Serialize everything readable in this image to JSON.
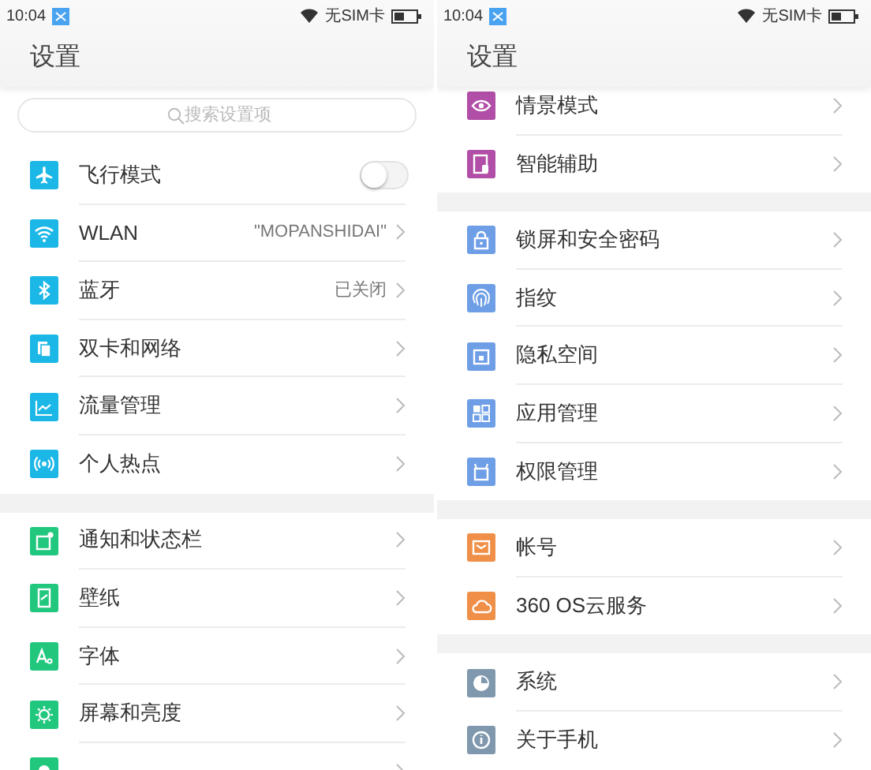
{
  "screens": [
    {
      "status_bar": {
        "time": "10:04",
        "carrier": "无SIM卡"
      },
      "title": "设置",
      "search": {
        "placeholder": "搜索设置项"
      },
      "groups": [
        {
          "items": [
            {
              "label": "飞行模式",
              "kind": "toggle",
              "on": false,
              "color": "#1bb7e6"
            },
            {
              "label": "WLAN",
              "kind": "link",
              "value": "\"MOPANSHIDAI\"",
              "color": "#1bb7e6"
            },
            {
              "label": "蓝牙",
              "kind": "link",
              "value": "已关闭",
              "color": "#1bb7e6"
            },
            {
              "label": "双卡和网络",
              "kind": "link",
              "color": "#1bb7e6"
            },
            {
              "label": "流量管理",
              "kind": "link",
              "color": "#1bb7e6"
            },
            {
              "label": "个人热点",
              "kind": "link",
              "color": "#1bb7e6"
            }
          ]
        },
        {
          "items": [
            {
              "label": "通知和状态栏",
              "kind": "link",
              "color": "#22c77e"
            },
            {
              "label": "壁纸",
              "kind": "link",
              "color": "#22c77e"
            },
            {
              "label": "字体",
              "kind": "link",
              "color": "#22c77e"
            },
            {
              "label": "屏幕和亮度",
              "kind": "link",
              "color": "#22c77e"
            },
            {
              "kind": "link",
              "color": "#22c77e"
            }
          ]
        }
      ]
    },
    {
      "status_bar": {
        "time": "10:04",
        "carrier": "无SIM卡"
      },
      "title": "设置",
      "groups": [
        {
          "items": [
            {
              "label": "情景模式",
              "kind": "link",
              "color": "#b14ea7"
            },
            {
              "label": "智能辅助",
              "kind": "link",
              "color": "#b14ea7"
            }
          ]
        },
        {
          "items": [
            {
              "label": "锁屏和安全密码",
              "kind": "link",
              "color": "#6e9ee6"
            },
            {
              "label": "指纹",
              "kind": "link",
              "color": "#6e9ee6"
            },
            {
              "label": "隐私空间",
              "kind": "link",
              "color": "#6e9ee6"
            },
            {
              "label": "应用管理",
              "kind": "link",
              "color": "#6e9ee6"
            },
            {
              "label": "权限管理",
              "kind": "link",
              "color": "#6e9ee6"
            }
          ]
        },
        {
          "items": [
            {
              "label": "帐号",
              "kind": "link",
              "color": "#f08f47"
            },
            {
              "label": "360 OS云服务",
              "kind": "link",
              "color": "#f08f47"
            }
          ]
        },
        {
          "items": [
            {
              "label": "系统",
              "kind": "link",
              "color": "#7f98ad"
            },
            {
              "label": "关于手机",
              "kind": "link",
              "color": "#7f98ad"
            }
          ]
        }
      ]
    }
  ]
}
